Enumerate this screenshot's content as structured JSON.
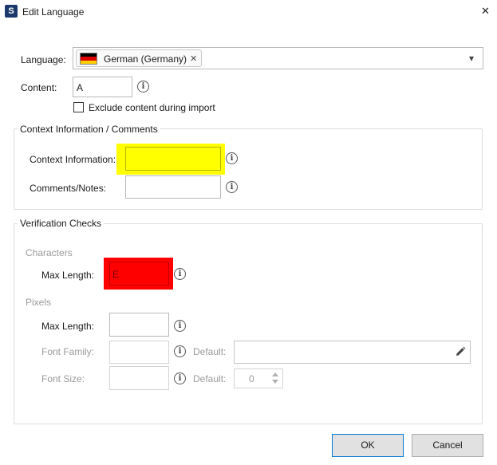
{
  "window": {
    "title": "Edit Language",
    "app_icon_glyph": "S",
    "close_glyph": "✕"
  },
  "language": {
    "label": "Language:",
    "chip_text": "German (Germany)",
    "chip_remove_glyph": "✕",
    "dropdown_glyph": "▾",
    "flag_colors": [
      "#000000",
      "#dd0000",
      "#ffce00"
    ]
  },
  "content": {
    "label": "Content:",
    "value": "A",
    "exclude_label": "Exclude content during import",
    "exclude_checked": false
  },
  "context_group": {
    "title": "Context Information / Comments",
    "context_label": "Context Information:",
    "context_value": "",
    "comments_label": "Comments/Notes:",
    "comments_value": ""
  },
  "verification": {
    "title": "Verification Checks",
    "characters_title": "Characters",
    "char_max_length_label": "Max Length:",
    "char_max_length_value": "E",
    "pixels_title": "Pixels",
    "pixel_max_length_label": "Max Length:",
    "pixel_max_length_value": "",
    "font_family_label": "Font Family:",
    "font_family_value": "",
    "font_family_default_label": "Default:",
    "font_family_default_value": "",
    "font_size_label": "Font Size:",
    "font_size_value": "",
    "font_size_default_label": "Default:",
    "font_size_default_value": "0"
  },
  "buttons": {
    "ok": "OK",
    "cancel": "Cancel"
  },
  "colors": {
    "highlight_yellow": "#ffff00",
    "highlight_red": "#ff0000",
    "primary_button_border": "#0078d7"
  }
}
